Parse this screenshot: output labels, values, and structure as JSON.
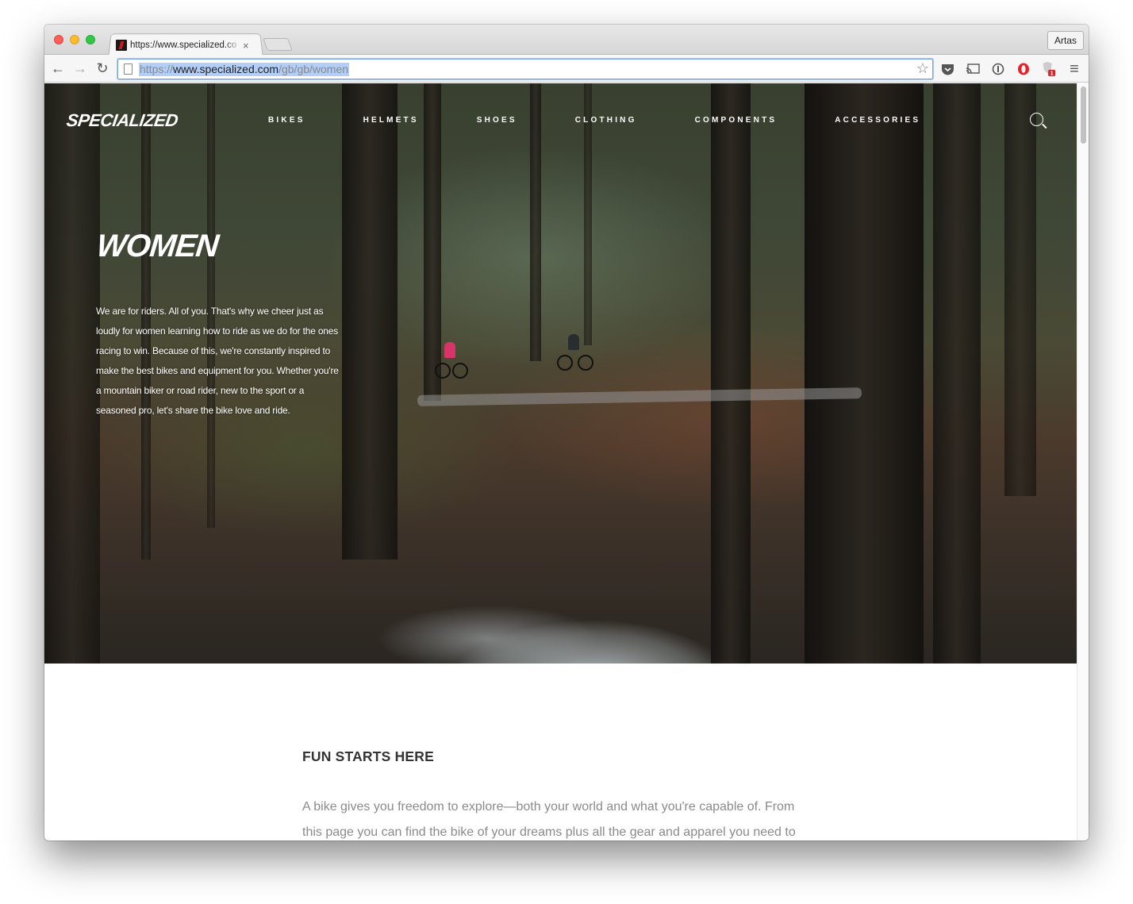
{
  "browser": {
    "tab_title": "https://www.specialized.co",
    "tab_close": "×",
    "profile_label": "Artas",
    "url_scheme": "https://",
    "url_host": "www.specialized.com",
    "url_path": "/gb/gb/women",
    "back_icon": "←",
    "forward_icon": "→",
    "reload_icon": "↻",
    "star_icon": "☆",
    "menu_icon": "≡"
  },
  "site": {
    "logo": "SPECIALIZED",
    "nav": [
      "BIKES",
      "HELMETS",
      "SHOES",
      "CLOTHING",
      "COMPONENTS",
      "ACCESSORIES"
    ]
  },
  "hero": {
    "title": "WOMEN",
    "lines": [
      "We are for riders. All of you. That's why we cheer just as",
      "loudly for women learning how to ride as we do for the ones",
      "racing to win. Because of this, we're constantly inspired to",
      "make the best bikes and equipment for you. Whether you're",
      "a mountain biker or road rider, new to the sport or a",
      "seasoned pro, let's share the bike love and ride."
    ]
  },
  "section": {
    "title": "FUN STARTS HERE",
    "lines": [
      "A bike gives you freedom to explore—both your world and what you're capable of. From",
      "this page you can find the bike of your dreams plus all the gear and apparel you need to"
    ]
  },
  "colors": {
    "url_highlight": "#b3cff7",
    "omnibox_border": "#7aa7e5",
    "rider_pink": "#d8346a",
    "rider_dark": "#2a2d30"
  }
}
